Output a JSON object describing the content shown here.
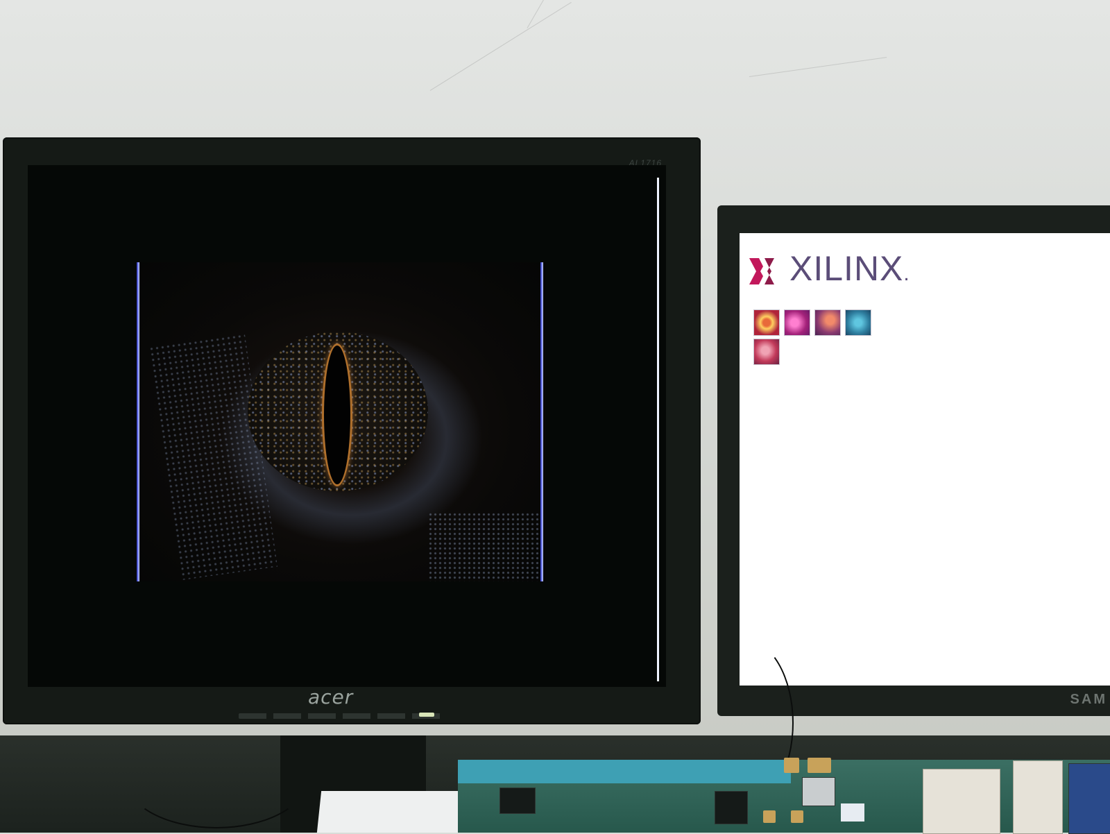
{
  "left_monitor": {
    "brand": "acer",
    "model": "AL1716"
  },
  "right_monitor": {
    "brand": "SAM",
    "screen": {
      "logo_text": "XILINX",
      "logo_dot": ".",
      "thumbnails": [
        "eye-thumbnail",
        "embryo-thumbnail",
        "bird-thumbnail",
        "texture-thumbnail",
        "portrait-thumbnail"
      ]
    }
  },
  "colors": {
    "xilinx_brand": "#c2185b",
    "xilinx_text": "#5b4d78",
    "screen_background": "#050806",
    "board_green": "#27584c"
  }
}
